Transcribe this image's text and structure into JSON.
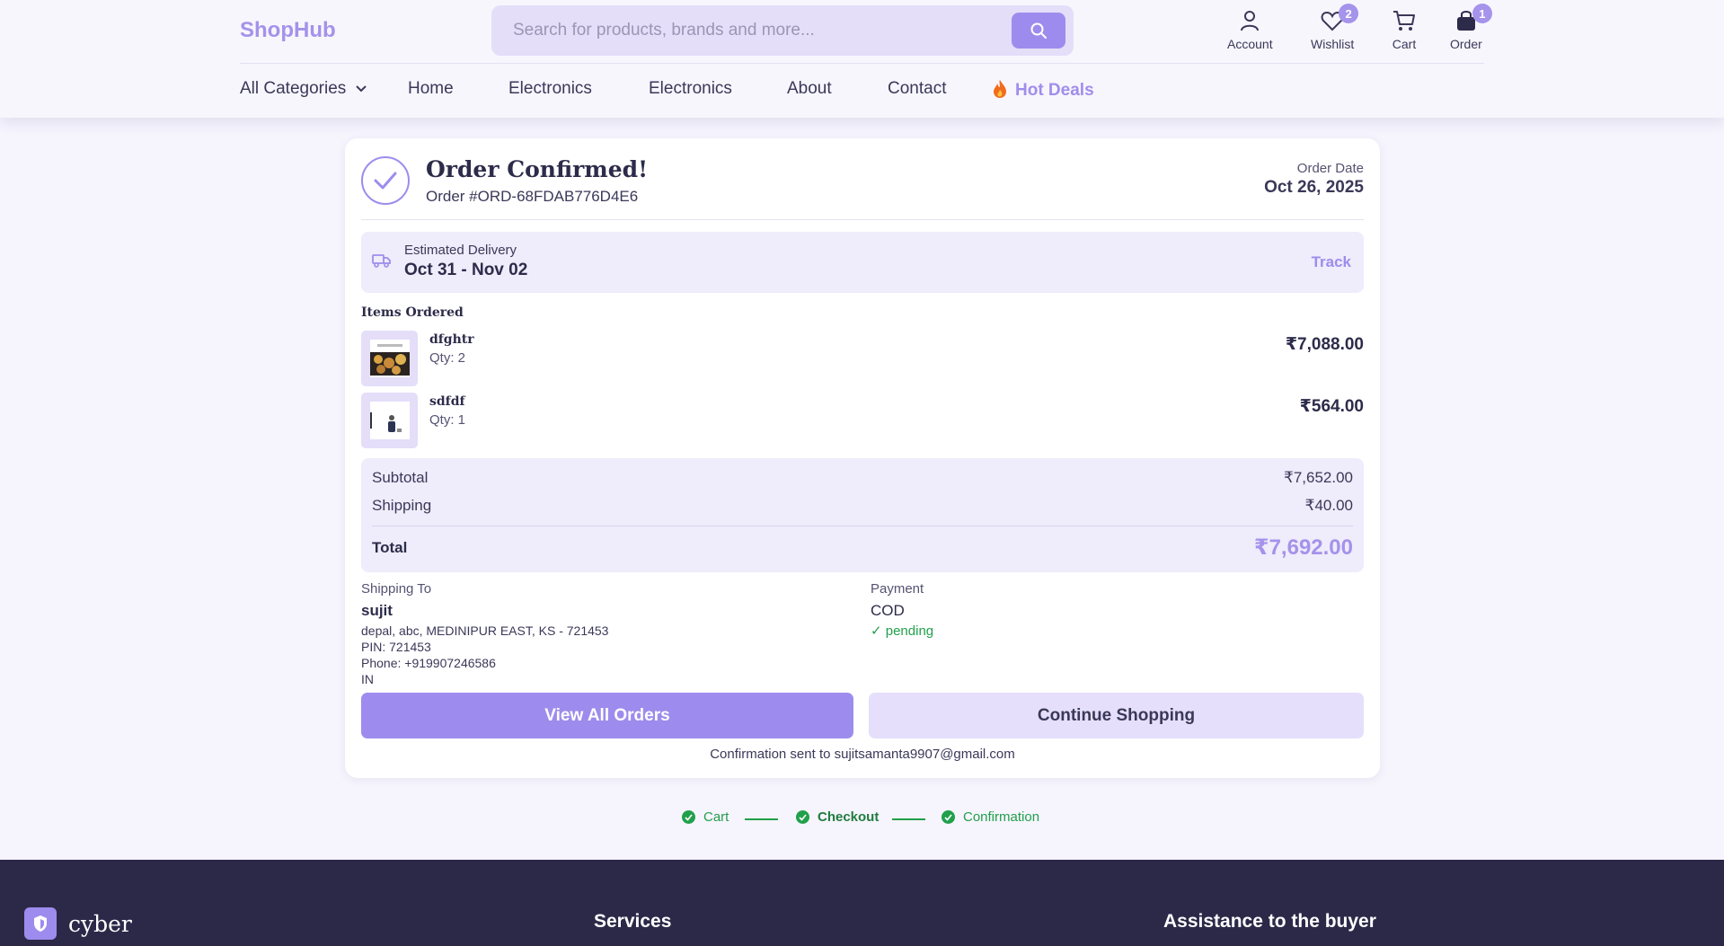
{
  "header": {
    "logo": "ShopHub",
    "search_placeholder": "Search for products, brands and more...",
    "icons": [
      {
        "label": "Account",
        "icon": "user-icon"
      },
      {
        "label": "Wishlist",
        "icon": "heart-icon",
        "badge": "2"
      },
      {
        "label": "Cart",
        "icon": "cart-icon"
      },
      {
        "label": "Order",
        "icon": "bag-icon",
        "badge": "1"
      }
    ],
    "menu": [
      {
        "label": "All Categories"
      },
      {
        "label": "Home"
      },
      {
        "label": "Electronics"
      },
      {
        "label": "Electronics"
      },
      {
        "label": "About"
      },
      {
        "label": "Contact"
      },
      {
        "label": "Hot Deals"
      }
    ]
  },
  "order": {
    "title": "Order Confirmed!",
    "order_number": "Order #ORD-68FDAB776D4E6",
    "date_label": "Order Date",
    "date": "Oct 26, 2025",
    "delivery_label": "Estimated Delivery",
    "delivery_range": "Oct 31 - Nov 02",
    "track_label": "Track",
    "items_title": "Items Ordered",
    "items": [
      {
        "name": "dfghtr",
        "qty": "Qty: 2",
        "price": "₹7,088.00"
      },
      {
        "name": "sdfdf",
        "qty": "Qty: 1",
        "price": "₹564.00"
      }
    ],
    "totals": {
      "subtotal_label": "Subtotal",
      "subtotal": "₹7,652.00",
      "shipping_label": "Shipping",
      "shipping": "₹40.00",
      "total_label": "Total",
      "total": "₹7,692.00"
    },
    "shipping_to": {
      "label": "Shipping To",
      "name": "sujit",
      "address": "depal, abc, MEDINIPUR EAST, KS - 721453",
      "pin": "PIN: 721453",
      "phone": "Phone: +919907246586",
      "country": "IN"
    },
    "payment": {
      "label": "Payment",
      "method": "COD",
      "status": "✓ pending"
    },
    "view_orders_label": "View All Orders",
    "continue_label": "Continue Shopping",
    "confirmation_note": "Confirmation sent to sujitsamanta9907@gmail.com"
  },
  "steps": [
    {
      "label": "Cart"
    },
    {
      "label": "Checkout"
    },
    {
      "label": "Confirmation"
    }
  ],
  "footer": {
    "brand": "cyber",
    "services_heading": "Services",
    "assistance_heading": "Assistance to the buyer"
  },
  "colors": {
    "accent": "#9d8ced",
    "success": "#21a04b",
    "footer_bg": "#2c2848"
  }
}
